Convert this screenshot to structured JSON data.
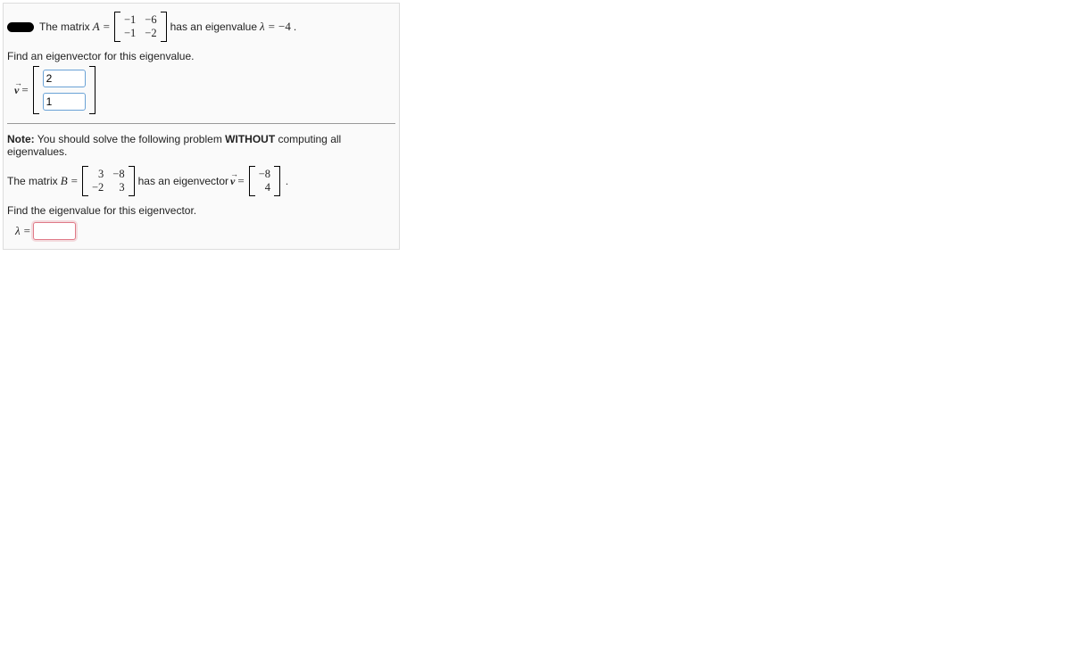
{
  "problem1": {
    "intro_1": "The matrix",
    "A_label": "A",
    "eq": "=",
    "A": [
      [
        "−1",
        "−6"
      ],
      [
        "−1",
        "−2"
      ]
    ],
    "intro_2": "has an eigenvalue",
    "lambda": "λ",
    "lambda_val": "−4",
    "period": ".",
    "find_line": "Find an eigenvector for this eigenvalue.",
    "v_label": "v",
    "v_input_top": "2",
    "v_input_bottom": "1"
  },
  "note_prefix": "Note:",
  "note_text_1": " You should solve the following problem ",
  "note_bold": "WITHOUT",
  "note_text_2": " computing all eigenvalues.",
  "problem2": {
    "intro_1": "The matrix",
    "B_label": "B",
    "eq": "=",
    "B": [
      [
        "3",
        "−8"
      ],
      [
        "−2",
        "3"
      ]
    ],
    "intro_2": "has an eigenvector",
    "v_label": "v",
    "v_vec": [
      "−8",
      "4"
    ],
    "period": ".",
    "find_line": "Find the eigenvalue for this eigenvector.",
    "lambda": "λ",
    "lambda_input": ""
  }
}
